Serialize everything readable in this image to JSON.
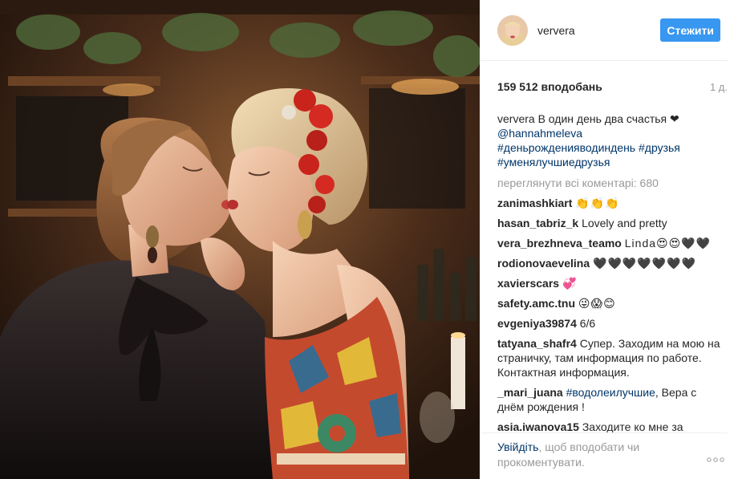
{
  "post": {
    "username": "ververa",
    "follow_label": "Стежити",
    "likes": "159 512 вподобань",
    "time": "1 д.",
    "caption": {
      "user": "ververa",
      "text": "В один день два счастья ❤",
      "mention": "@hannahmeleva",
      "tags": [
        "#деньрожденияводиндень",
        "#друзья",
        "#уменялучшиедрузья"
      ]
    },
    "load_more": "переглянути всі коментарі: 680",
    "comments": [
      {
        "user": "zanimashkiart",
        "text": "👏👏👏"
      },
      {
        "user": "hasan_tabriz_k",
        "text": "Lovely and pretty"
      },
      {
        "user": "vera_brezhneva_teamo",
        "text": "Linda😍😍🖤🖤"
      },
      {
        "user": "rodionovaevelina",
        "text": "🖤🖤🖤🖤🖤🖤🖤"
      },
      {
        "user": "xavierscars",
        "text": "💞"
      },
      {
        "user": "safety.amc.tnu",
        "text": "😜😱😊"
      },
      {
        "user": "evgeniya39874",
        "text": "6/6"
      },
      {
        "user": "tatyana_shafr4",
        "text": "Супер. Заходим на мою на страничку, там информация по работе. Контактная информация."
      },
      {
        "user": "_mari_juana",
        "tag": "#водолеилучшие",
        "text": ", Вера с днём рождения !"
      },
      {
        "user": "asia.iwanova15",
        "text": "Заходите ко мне за"
      }
    ],
    "footer": {
      "login_link": "Увійдіть",
      "login_text": ", щоб вподобати чи прокоментувати."
    },
    "more_icon": "more-options-icon",
    "colors": {
      "accent": "#3897f0",
      "link": "#003569",
      "muted": "#999999"
    }
  }
}
